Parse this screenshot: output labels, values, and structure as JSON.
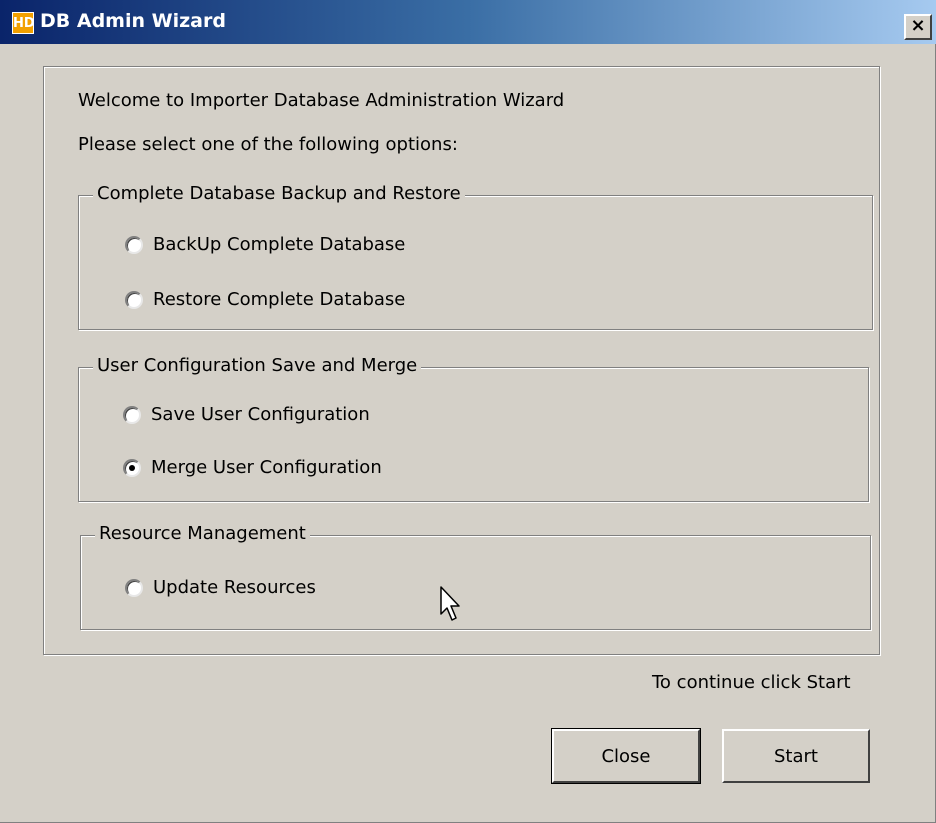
{
  "window": {
    "title": "DB Admin Wizard",
    "close_glyph": "×"
  },
  "intro": {
    "welcome": "Welcome to Importer Database Administration Wizard",
    "instruction": "Please select one of the following options:"
  },
  "groups": [
    {
      "title": "Complete Database Backup and Restore",
      "options": [
        {
          "label": "BackUp Complete Database",
          "selected": false
        },
        {
          "label": "Restore Complete Database",
          "selected": false
        }
      ]
    },
    {
      "title": "User Configuration Save and Merge",
      "options": [
        {
          "label": "Save User Configuration",
          "selected": false
        },
        {
          "label": "Merge User Configuration",
          "selected": true
        }
      ]
    },
    {
      "title": "Resource Management",
      "options": [
        {
          "label": "Update Resources",
          "selected": false
        }
      ]
    }
  ],
  "footer": {
    "hint": "To continue click Start",
    "close_label": "Close",
    "start_label": "Start"
  },
  "icons": {
    "app_icon": "hd-logo-icon",
    "mouse_cursor": "arrow-cursor-icon"
  },
  "colors": {
    "titlebar_start": "#0a246a",
    "titlebar_end": "#a6caf0",
    "dialog_bg": "#d4d0c8"
  }
}
